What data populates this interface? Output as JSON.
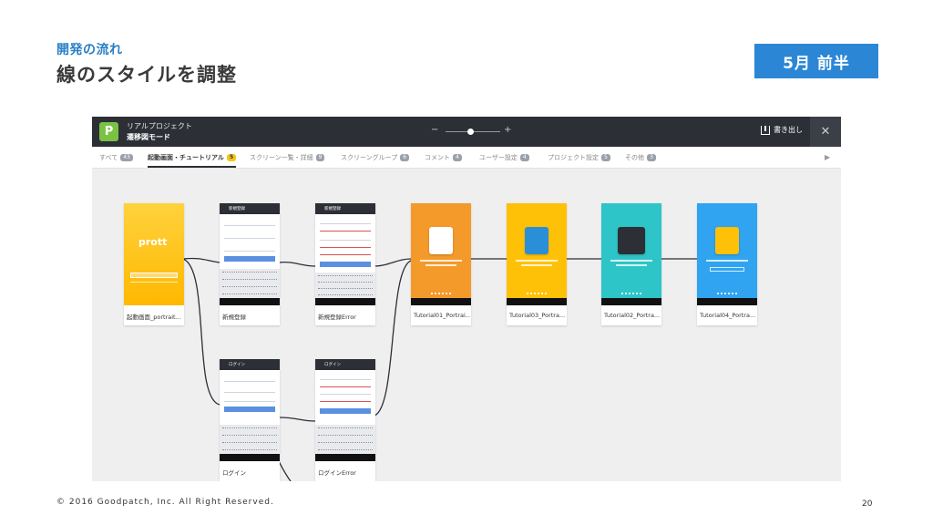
{
  "slide": {
    "subtitle": "開発の流れ",
    "title": "線のスタイルを調整",
    "badge": "5月 前半",
    "copyright": "© 2016 Goodpatch, Inc. All Right Reserved.",
    "page_number": "20"
  },
  "app": {
    "logo_glyph": "P",
    "project_name": "リアルプロジェクト",
    "mode_name": "遷移図モード",
    "zoom_minus": "−",
    "zoom_plus": "+",
    "export_label": "書き出し",
    "close_glyph": "✕",
    "tabs": [
      {
        "label": "すべて",
        "count": "43"
      },
      {
        "label": "起動画面・チュートリアル",
        "count": "5"
      },
      {
        "label": "スクリーン一覧・詳細",
        "count": "9"
      },
      {
        "label": "スクリーングループ",
        "count": "6"
      },
      {
        "label": "コメント",
        "count": "4"
      },
      {
        "label": "ユーザー設定",
        "count": "4"
      },
      {
        "label": "プロジェクト設定",
        "count": "5"
      },
      {
        "label": "その他",
        "count": "3"
      }
    ],
    "active_tab": 1,
    "tab_arrow": "▶",
    "splash_logo": "prott",
    "screens": [
      {
        "label": "起動画面_portrait..."
      },
      {
        "label": "新規登録",
        "form_title": "新規登録"
      },
      {
        "label": "新規登録Error",
        "form_title": "新規登録"
      },
      {
        "label": "Tutorial01_Portrai..."
      },
      {
        "label": "Tutorial03_Portra..."
      },
      {
        "label": "Tutorial02_Portra..."
      },
      {
        "label": "Tutorial04_Portra..."
      },
      {
        "label": "ログイン",
        "form_title": "ログイン"
      },
      {
        "label": "ログインError",
        "form_title": "ログイン"
      }
    ],
    "colors": {
      "splash": "#ffc11e",
      "tutorial01": "#f39a2b",
      "tutorial03": "#ffc107",
      "tutorial02": "#2ec5c8",
      "tutorial04": "#30a4f0"
    }
  }
}
